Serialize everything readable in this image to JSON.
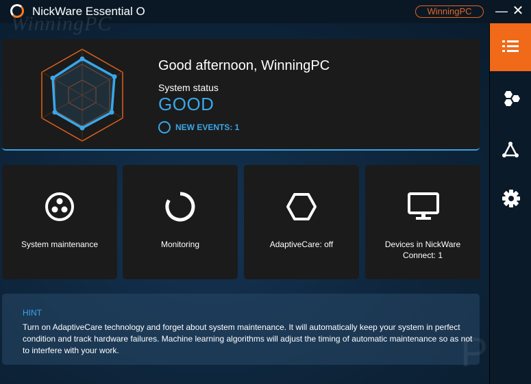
{
  "window": {
    "title": "NickWare Essential O",
    "watermark": "WinningPC",
    "user_badge": "WinningPC",
    "minimize_glyph": "—",
    "close_glyph": "✕"
  },
  "status": {
    "greeting": "Good afternoon, WinningPC",
    "label": "System status",
    "value": "GOOD",
    "events_label": "NEW EVENTS: 1"
  },
  "tiles": [
    {
      "label": "System maintenance",
      "icon": "maintenance-icon"
    },
    {
      "label": "Monitoring",
      "icon": "monitoring-ring-icon"
    },
    {
      "label": "AdaptiveCare: off",
      "icon": "hexagon-icon"
    },
    {
      "label": "Devices in NickWare Connect: 1",
      "icon": "monitor-icon"
    }
  ],
  "hint": {
    "title": "HINT",
    "text": "Turn on AdaptiveCare technology and forget about system maintenance. It will automatically keep your system in perfect condition and track hardware failures. Machine learning algorithms will adjust the timing of automatic maintenance so as not to interfere with your work."
  },
  "rail": [
    {
      "icon": "list-icon",
      "active": true
    },
    {
      "icon": "hexagons-icon",
      "active": false
    },
    {
      "icon": "network-icon",
      "active": false
    },
    {
      "icon": "gear-icon",
      "active": false
    }
  ],
  "watermark_corner": "PC",
  "colors": {
    "accent_blue": "#3aa7ea",
    "accent_orange": "#f06a1a",
    "tile_bg": "#1b1b1b",
    "background": "#0d2338"
  }
}
